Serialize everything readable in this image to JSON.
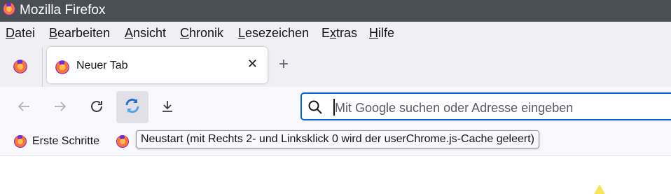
{
  "window": {
    "title": "Mozilla Firefox"
  },
  "menubar": {
    "items": [
      {
        "underline": "D",
        "rest": "atei"
      },
      {
        "underline": "B",
        "rest": "earbeiten"
      },
      {
        "underline": "A",
        "rest": "nsicht"
      },
      {
        "underline": "C",
        "rest": "hronik"
      },
      {
        "underline": "L",
        "rest": "esezeichen"
      },
      {
        "pre": "E",
        "underline": "x",
        "rest": "tras"
      },
      {
        "underline": "H",
        "rest": "ilfe"
      }
    ]
  },
  "tabs": {
    "active_label": "Neuer Tab",
    "close_glyph": "✕",
    "new_tab_glyph": "+"
  },
  "navbar": {
    "back_icon": "back-arrow-icon",
    "forward_icon": "forward-arrow-icon",
    "reload_icon": "reload-icon",
    "restart_icon": "restart-icon",
    "downloads_icon": "download-icon",
    "url_placeholder": "Mit Google suchen oder Adresse eingeben"
  },
  "bookmarks": {
    "items": [
      {
        "label": "Erste Schritte"
      }
    ]
  },
  "tooltip": {
    "text": "Neustart (mit Rechts 2- und Linksklick 0 wird der userChrome.js-Cache geleert)"
  },
  "colors": {
    "titlebar": "#4a4f55",
    "accent": "#0061e0",
    "firefox_orange": "#ff7139",
    "firefox_purple": "#6e2bd9"
  }
}
